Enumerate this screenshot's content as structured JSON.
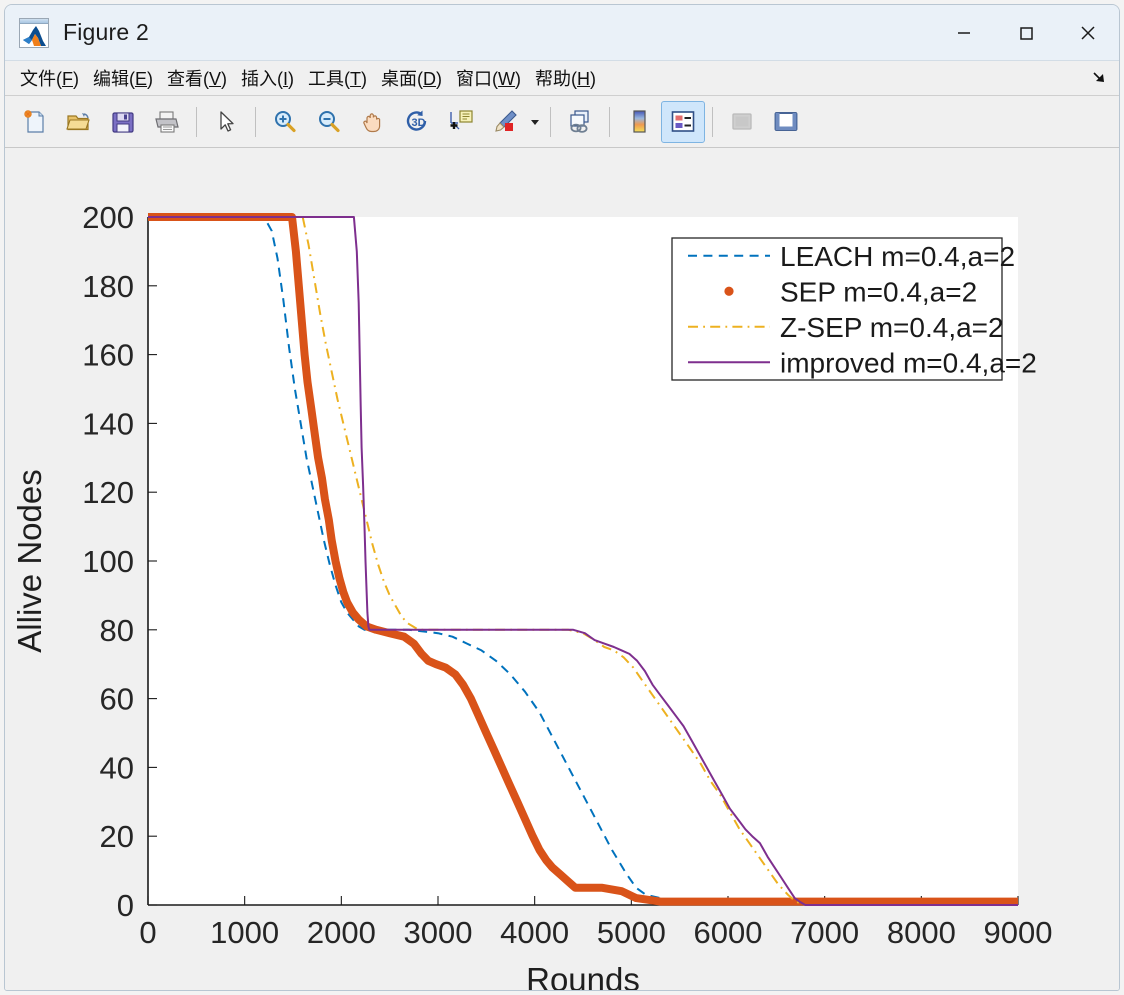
{
  "window": {
    "title": "Figure 2",
    "icon": "matlab-icon",
    "buttons": [
      {
        "name": "minimize-button",
        "glyph": "minimize"
      },
      {
        "name": "maximize-button",
        "glyph": "maximize"
      },
      {
        "name": "close-button",
        "glyph": "close"
      }
    ]
  },
  "menubar": {
    "items": [
      {
        "label": "文件(F)",
        "text": "文件(",
        "key": "F",
        "tail": ")"
      },
      {
        "label": "编辑(E)",
        "text": "编辑(",
        "key": "E",
        "tail": ")"
      },
      {
        "label": "查看(V)",
        "text": "查看(",
        "key": "V",
        "tail": ")"
      },
      {
        "label": "插入(I)",
        "text": "插入(",
        "key": "I",
        "tail": ")"
      },
      {
        "label": "工具(T)",
        "text": "工具(",
        "key": "T",
        "tail": ")"
      },
      {
        "label": "桌面(D)",
        "text": "桌面(",
        "key": "D",
        "tail": ")"
      },
      {
        "label": "窗口(W)",
        "text": "窗口(",
        "key": "W",
        "tail": ")"
      },
      {
        "label": "帮助(H)",
        "text": "帮助(",
        "key": "H",
        "tail": ")"
      }
    ],
    "dock_arrow": "dock-arrow-icon"
  },
  "toolbar": {
    "items": [
      {
        "name": "new-figure-button",
        "icon": "new-document-icon"
      },
      {
        "name": "open-file-button",
        "icon": "open-folder-icon"
      },
      {
        "name": "save-figure-button",
        "icon": "save-disk-icon"
      },
      {
        "name": "print-figure-button",
        "icon": "printer-icon"
      },
      {
        "name": "separator-1",
        "icon": "separator"
      },
      {
        "name": "pointer-select-button",
        "icon": "cursor-arrow-icon"
      },
      {
        "name": "separator-2",
        "icon": "separator"
      },
      {
        "name": "zoom-in-button",
        "icon": "zoom-in-icon"
      },
      {
        "name": "zoom-out-button",
        "icon": "zoom-out-icon"
      },
      {
        "name": "pan-button",
        "icon": "hand-pan-icon"
      },
      {
        "name": "rotate-3d-button",
        "icon": "rotate-3d-icon"
      },
      {
        "name": "data-cursor-button",
        "icon": "data-cursor-icon"
      },
      {
        "name": "brush-button",
        "icon": "brush-icon"
      },
      {
        "name": "brush-dropdown",
        "icon": "chevron-down-icon"
      },
      {
        "name": "separator-3",
        "icon": "separator"
      },
      {
        "name": "link-data-button",
        "icon": "link-plot-icon"
      },
      {
        "name": "separator-4",
        "icon": "separator"
      },
      {
        "name": "colorbar-button",
        "icon": "colorbar-icon"
      },
      {
        "name": "legend-button",
        "icon": "legend-icon",
        "active": true
      },
      {
        "name": "separator-5",
        "icon": "separator"
      },
      {
        "name": "hide-plot-tools-button",
        "icon": "hide-plot-tools-icon",
        "disabled": true
      },
      {
        "name": "show-plot-tools-button",
        "icon": "show-plot-tools-icon"
      }
    ]
  },
  "chart_data": {
    "type": "line",
    "title": "",
    "xlabel": "Rounds",
    "ylabel": "Allive Nodes",
    "xlim": [
      0,
      9000
    ],
    "ylim": [
      0,
      200
    ],
    "xticks": [
      0,
      1000,
      2000,
      3000,
      4000,
      5000,
      6000,
      7000,
      8000,
      9000
    ],
    "yticks": [
      0,
      20,
      40,
      60,
      80,
      100,
      120,
      140,
      160,
      180,
      200
    ],
    "grid": false,
    "legend_position": "top-right",
    "background": "#ffffff",
    "figure_background": "#f0f0f0",
    "series": [
      {
        "name": "LEACH  m=0.4,a=2",
        "color": "#0072BD",
        "style": "dashed",
        "width": 2,
        "marker": "none",
        "points": [
          [
            0,
            200
          ],
          [
            1200,
            200
          ],
          [
            1280,
            196
          ],
          [
            1340,
            188
          ],
          [
            1400,
            176
          ],
          [
            1460,
            162
          ],
          [
            1520,
            150
          ],
          [
            1580,
            140
          ],
          [
            1640,
            130
          ],
          [
            1700,
            122
          ],
          [
            1760,
            114
          ],
          [
            1820,
            106
          ],
          [
            1880,
            99
          ],
          [
            1940,
            93
          ],
          [
            2000,
            88
          ],
          [
            2060,
            85
          ],
          [
            2120,
            83
          ],
          [
            2180,
            81
          ],
          [
            2240,
            80
          ],
          [
            2400,
            80
          ],
          [
            2700,
            80
          ],
          [
            3000,
            79
          ],
          [
            3150,
            78
          ],
          [
            3300,
            76
          ],
          [
            3450,
            74
          ],
          [
            3600,
            71
          ],
          [
            3750,
            67
          ],
          [
            3900,
            62
          ],
          [
            4050,
            56
          ],
          [
            4200,
            48
          ],
          [
            4350,
            40
          ],
          [
            4500,
            32
          ],
          [
            4650,
            24
          ],
          [
            4800,
            16
          ],
          [
            4950,
            9
          ],
          [
            5050,
            5
          ],
          [
            5150,
            3
          ],
          [
            5300,
            2
          ],
          [
            5500,
            1
          ],
          [
            5800,
            1
          ],
          [
            6300,
            1
          ],
          [
            7000,
            1
          ],
          [
            8000,
            1
          ],
          [
            9000,
            1
          ]
        ]
      },
      {
        "name": "SEP  m=0.4,a=2",
        "color": "#D95319",
        "style": "solid",
        "width": 8,
        "marker": "dot",
        "points": [
          [
            0,
            200
          ],
          [
            1490,
            200
          ],
          [
            1530,
            190
          ],
          [
            1560,
            180
          ],
          [
            1590,
            170
          ],
          [
            1620,
            160
          ],
          [
            1650,
            152
          ],
          [
            1690,
            144
          ],
          [
            1730,
            136
          ],
          [
            1760,
            130
          ],
          [
            1800,
            124
          ],
          [
            1830,
            118
          ],
          [
            1870,
            112
          ],
          [
            1900,
            106
          ],
          [
            1940,
            100
          ],
          [
            1980,
            95
          ],
          [
            2020,
            91
          ],
          [
            2060,
            88
          ],
          [
            2120,
            85
          ],
          [
            2180,
            83
          ],
          [
            2260,
            81
          ],
          [
            2360,
            80
          ],
          [
            2500,
            79
          ],
          [
            2650,
            78
          ],
          [
            2750,
            76
          ],
          [
            2830,
            73
          ],
          [
            2900,
            71
          ],
          [
            2980,
            70
          ],
          [
            3080,
            69
          ],
          [
            3180,
            67
          ],
          [
            3260,
            64
          ],
          [
            3340,
            60
          ],
          [
            3420,
            55
          ],
          [
            3500,
            50
          ],
          [
            3580,
            45
          ],
          [
            3660,
            40
          ],
          [
            3740,
            35
          ],
          [
            3820,
            30
          ],
          [
            3900,
            25
          ],
          [
            3980,
            20
          ],
          [
            4050,
            16
          ],
          [
            4120,
            13
          ],
          [
            4180,
            11
          ],
          [
            4260,
            9
          ],
          [
            4340,
            7
          ],
          [
            4420,
            5
          ],
          [
            4500,
            5
          ],
          [
            4700,
            5
          ],
          [
            4900,
            4
          ],
          [
            5050,
            2
          ],
          [
            5300,
            1
          ],
          [
            5700,
            1
          ],
          [
            6200,
            1
          ],
          [
            6800,
            1
          ],
          [
            7500,
            1
          ],
          [
            8300,
            1
          ],
          [
            9000,
            1
          ]
        ]
      },
      {
        "name": "Z-SEP  m=0.4,a=2",
        "color": "#EDB120",
        "style": "dashdot",
        "width": 2,
        "marker": "none",
        "points": [
          [
            0,
            200
          ],
          [
            1600,
            200
          ],
          [
            1660,
            192
          ],
          [
            1720,
            182
          ],
          [
            1780,
            172
          ],
          [
            1840,
            163
          ],
          [
            1900,
            155
          ],
          [
            1960,
            147
          ],
          [
            2020,
            140
          ],
          [
            2080,
            133
          ],
          [
            2140,
            126
          ],
          [
            2200,
            119
          ],
          [
            2260,
            112
          ],
          [
            2320,
            105
          ],
          [
            2380,
            99
          ],
          [
            2440,
            94
          ],
          [
            2500,
            90
          ],
          [
            2560,
            87
          ],
          [
            2620,
            84
          ],
          [
            2680,
            82
          ],
          [
            2740,
            81
          ],
          [
            2800,
            80
          ],
          [
            3200,
            80
          ],
          [
            3800,
            80
          ],
          [
            4350,
            80
          ],
          [
            4500,
            79
          ],
          [
            4620,
            77
          ],
          [
            4720,
            75
          ],
          [
            4820,
            74
          ],
          [
            4920,
            72
          ],
          [
            5020,
            69
          ],
          [
            5120,
            65
          ],
          [
            5220,
            61
          ],
          [
            5320,
            57
          ],
          [
            5420,
            53
          ],
          [
            5520,
            49
          ],
          [
            5620,
            45
          ],
          [
            5720,
            41
          ],
          [
            5820,
            36
          ],
          [
            5920,
            32
          ],
          [
            6020,
            27
          ],
          [
            6120,
            22
          ],
          [
            6220,
            18
          ],
          [
            6320,
            14
          ],
          [
            6420,
            10
          ],
          [
            6520,
            6
          ],
          [
            6620,
            3
          ],
          [
            6700,
            1
          ],
          [
            6800,
            0
          ],
          [
            7200,
            0
          ],
          [
            8000,
            0
          ],
          [
            9000,
            0
          ]
        ]
      },
      {
        "name": "improved  m=0.4,a=2",
        "color": "#7E2F8E",
        "style": "solid",
        "width": 2,
        "marker": "none",
        "points": [
          [
            0,
            200
          ],
          [
            2130,
            200
          ],
          [
            2160,
            190
          ],
          [
            2180,
            175
          ],
          [
            2190,
            160
          ],
          [
            2200,
            145
          ],
          [
            2210,
            133
          ],
          [
            2225,
            122
          ],
          [
            2240,
            110
          ],
          [
            2250,
            100
          ],
          [
            2260,
            92
          ],
          [
            2270,
            85
          ],
          [
            2280,
            81
          ],
          [
            2290,
            80
          ],
          [
            2600,
            80
          ],
          [
            3200,
            80
          ],
          [
            3900,
            80
          ],
          [
            4400,
            80
          ],
          [
            4520,
            79
          ],
          [
            4620,
            77
          ],
          [
            4720,
            76
          ],
          [
            4820,
            75
          ],
          [
            4900,
            74
          ],
          [
            4980,
            73
          ],
          [
            5060,
            71
          ],
          [
            5140,
            68
          ],
          [
            5220,
            64
          ],
          [
            5300,
            61
          ],
          [
            5380,
            58
          ],
          [
            5460,
            55
          ],
          [
            5540,
            52
          ],
          [
            5620,
            48
          ],
          [
            5700,
            44
          ],
          [
            5780,
            40
          ],
          [
            5860,
            36
          ],
          [
            5940,
            32
          ],
          [
            6020,
            28
          ],
          [
            6100,
            25
          ],
          [
            6180,
            22
          ],
          [
            6250,
            20
          ],
          [
            6330,
            18
          ],
          [
            6410,
            14
          ],
          [
            6480,
            11
          ],
          [
            6550,
            8
          ],
          [
            6620,
            5
          ],
          [
            6690,
            2
          ],
          [
            6740,
            1
          ],
          [
            6800,
            0
          ],
          [
            7400,
            0
          ],
          [
            8200,
            0
          ],
          [
            9000,
            0
          ]
        ]
      }
    ]
  }
}
